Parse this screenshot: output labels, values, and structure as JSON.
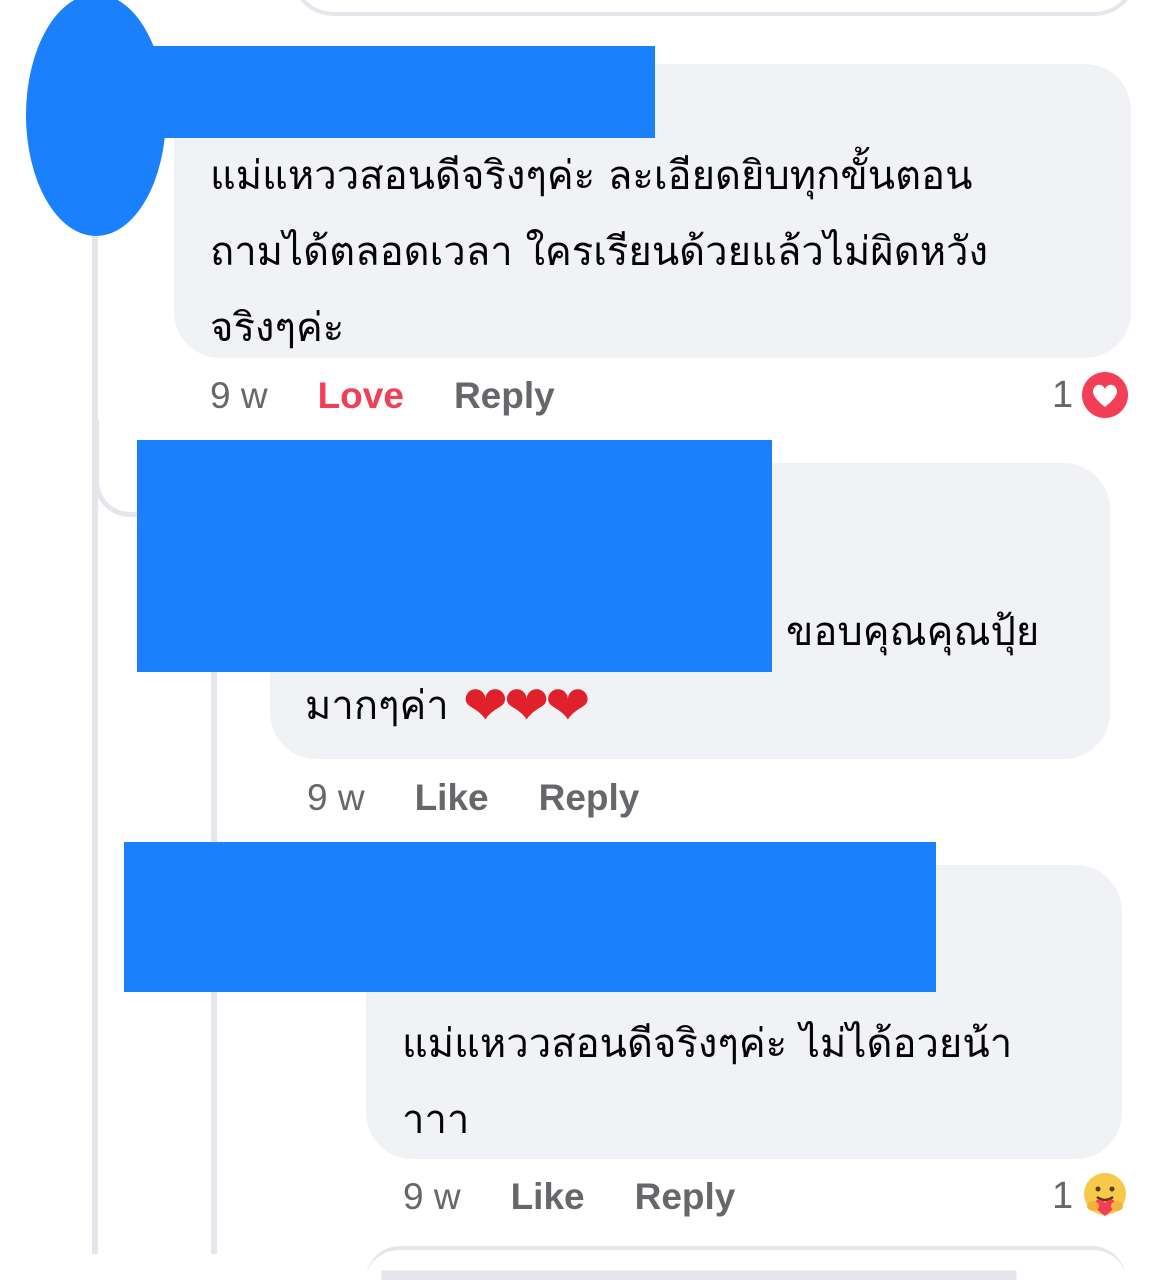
{
  "comments": [
    {
      "text": "แม่แหววสอนดีจริงๆค่ะ ละเอียดยิบทุกขั้นตอน\nถามได้ตลอดเวลา ใครเรียนด้วยแล้วไม่ผิดหวัง\nจริงๆค่ะ",
      "time": "9 w",
      "reaction_action": "Love",
      "reply_label": "Reply",
      "reaction_count": "1",
      "reaction_icon": "love-heart-icon"
    },
    {
      "text_line1": "ขอบคุณคุณปุ้ย",
      "text_line2": "มากๆค่า",
      "hearts": "❤❤❤",
      "time": "9 w",
      "like_label": "Like",
      "reply_label": "Reply"
    },
    {
      "text": "แม่แหววสอนดีจริงๆค่ะ ไม่ได้อวยน้า\nาาา",
      "time": "9 w",
      "like_label": "Like",
      "reply_label": "Reply",
      "reaction_count": "1",
      "reaction_icon": "care-hug-icon"
    }
  ],
  "colors": {
    "bubble": "#f0f2f5",
    "meta_text": "#65676b",
    "love": "#f33e58",
    "redaction": "#1a80fb"
  }
}
